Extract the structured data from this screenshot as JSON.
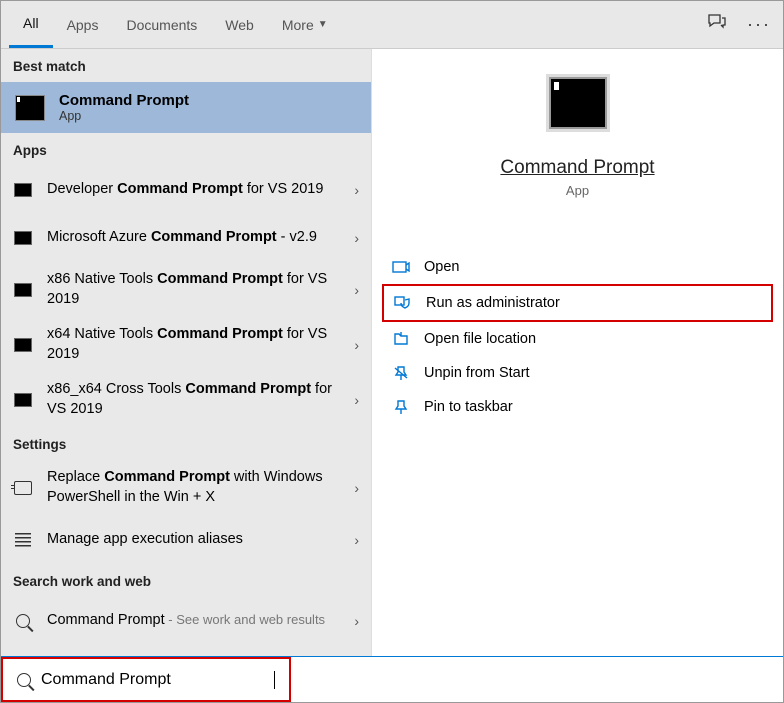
{
  "tabs": {
    "all": "All",
    "apps": "Apps",
    "documents": "Documents",
    "web": "Web",
    "more": "More"
  },
  "sections": {
    "best_match": "Best match",
    "apps": "Apps",
    "settings": "Settings",
    "work_web": "Search work and web"
  },
  "best_match": {
    "title": "Command Prompt",
    "subtitle": "App"
  },
  "apps_list": [
    {
      "pre": "Developer ",
      "bold": "Command Prompt",
      "post": " for VS 2019"
    },
    {
      "pre": "Microsoft Azure ",
      "bold": "Command Prompt",
      "post": " - v2.9"
    },
    {
      "pre": "x86 Native Tools ",
      "bold": "Command Prompt",
      "post": " for VS 2019"
    },
    {
      "pre": "x64 Native Tools ",
      "bold": "Command Prompt",
      "post": " for VS 2019"
    },
    {
      "pre": "x86_x64 Cross Tools ",
      "bold": "Command Prompt",
      "post": " for VS 2019"
    }
  ],
  "settings_list": [
    {
      "pre": "Replace ",
      "bold": "Command Prompt",
      "post": " with Windows PowerShell in the Win + X"
    },
    {
      "pre": "Manage app execution aliases",
      "bold": "",
      "post": ""
    }
  ],
  "work_web": {
    "label": "Command Prompt",
    "hint": " - See work and web results"
  },
  "preview": {
    "title": "Command Prompt",
    "subtitle": "App"
  },
  "actions": {
    "open": "Open",
    "run_admin": "Run as administrator",
    "open_loc": "Open file location",
    "unpin": "Unpin from Start",
    "pin_tb": "Pin to taskbar"
  },
  "search": {
    "value": "Command Prompt"
  }
}
